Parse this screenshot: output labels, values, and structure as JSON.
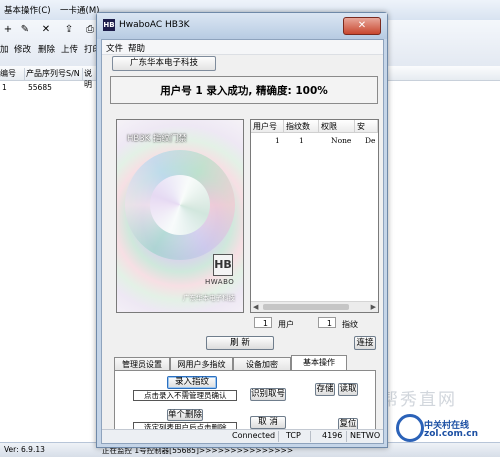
{
  "background_app": {
    "menus": [
      "基本操作(C)",
      "一卡通(M)"
    ],
    "toolbar": [
      "加",
      "修改",
      "删除",
      "上传",
      "打印"
    ],
    "columns": [
      "编号",
      "产品序列号S/N",
      "说明"
    ],
    "row": {
      "id": "1",
      "serial": "55685"
    },
    "status": {
      "version": "Ver: 6.9.13",
      "monitor": "正在监控 1号控制器[55685]>>>>>>>>>>>>>>>"
    }
  },
  "dialog": {
    "title": "HwaboAC HB3K",
    "menus": [
      "文件",
      "帮助"
    ],
    "company_button": "广东华本电子科技",
    "status_message": "用户号 1 录入成功,  精确度: 100%",
    "image_panel": {
      "title": "HB3K 指纹门禁",
      "logo_letter": "HB",
      "logo_text": "HWABO",
      "company": "广东华本电子科技"
    },
    "table": {
      "headers": [
        "用户号",
        "指纹数",
        "权限",
        "安"
      ],
      "rows": [
        {
          "user": "1",
          "count": "1",
          "perm": "None",
          "sec": "De"
        }
      ]
    },
    "counts": {
      "users_value": "1",
      "users_label": "用户",
      "fp_value": "1",
      "fp_label": "指纹"
    },
    "buttons": {
      "refresh": "刷  新",
      "connect": "连接",
      "enroll": "录入指纹",
      "identify": "识别取号",
      "single_delete": "单个删除",
      "cancel": "取  消",
      "store": "存储",
      "read": "读取",
      "reset": "复位"
    },
    "tabs": [
      "管理员设置",
      "网用户多指纹",
      "设备加密",
      "基本操作"
    ],
    "inputs": {
      "enroll_hint": "点击录入不需管理员确认",
      "delete_hint": "选定列表用户后点击删除"
    },
    "statusbar": {
      "state": "Connected",
      "protocol": "TCP",
      "port": "4196",
      "net": "NETWO"
    }
  },
  "watermark": {
    "site": "中关村在线",
    "domain": "zol.com.cn"
  }
}
